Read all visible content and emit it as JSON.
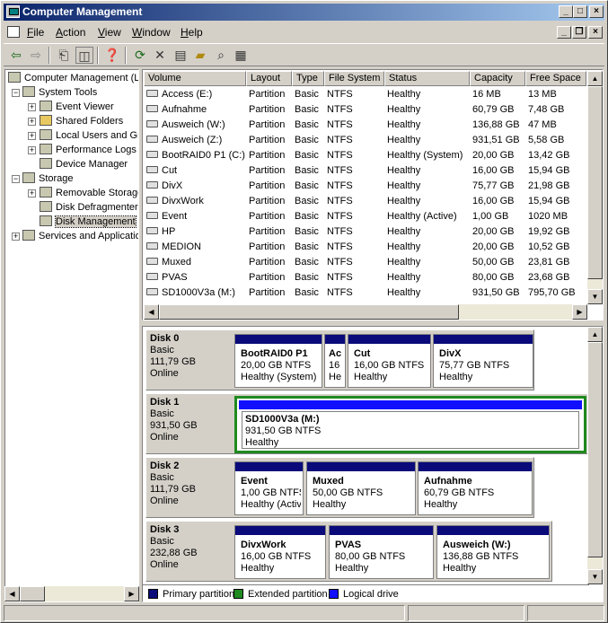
{
  "window": {
    "title": "Computer Management"
  },
  "menu": [
    "File",
    "Action",
    "View",
    "Window",
    "Help"
  ],
  "tree": [
    {
      "label": "Computer Management (Local)",
      "level": 0,
      "icon": "computer-icon"
    },
    {
      "label": "System Tools",
      "level": 1,
      "icon": "tools-icon"
    },
    {
      "label": "Event Viewer",
      "level": 2,
      "icon": "event-viewer-icon"
    },
    {
      "label": "Shared Folders",
      "level": 2,
      "icon": "shared-folders-icon"
    },
    {
      "label": "Local Users and Groups",
      "level": 2,
      "icon": "users-icon"
    },
    {
      "label": "Performance Logs and Alerts",
      "level": 2,
      "icon": "performance-icon"
    },
    {
      "label": "Device Manager",
      "level": 2,
      "icon": "device-manager-icon"
    },
    {
      "label": "Storage",
      "level": 1,
      "icon": "storage-icon"
    },
    {
      "label": "Removable Storage",
      "level": 2,
      "icon": "removable-storage-icon"
    },
    {
      "label": "Disk Defragmenter",
      "level": 2,
      "icon": "defrag-icon"
    },
    {
      "label": "Disk Management",
      "level": 2,
      "icon": "disk-management-icon",
      "selected": true
    },
    {
      "label": "Services and Applications",
      "level": 1,
      "icon": "services-icon"
    }
  ],
  "columns": [
    "Volume",
    "Layout",
    "Type",
    "File System",
    "Status",
    "Capacity",
    "Free Space"
  ],
  "volumes": [
    [
      "Access (E:)",
      "Partition",
      "Basic",
      "NTFS",
      "Healthy",
      "16 MB",
      "13 MB"
    ],
    [
      "Aufnahme",
      "Partition",
      "Basic",
      "NTFS",
      "Healthy",
      "60,79 GB",
      "7,48 GB"
    ],
    [
      "Ausweich (W:)",
      "Partition",
      "Basic",
      "NTFS",
      "Healthy",
      "136,88 GB",
      "47 MB"
    ],
    [
      "Ausweich (Z:)",
      "Partition",
      "Basic",
      "NTFS",
      "Healthy",
      "931,51 GB",
      "5,58 GB"
    ],
    [
      "BootRAID0 P1 (C:)",
      "Partition",
      "Basic",
      "NTFS",
      "Healthy (System)",
      "20,00 GB",
      "13,42 GB"
    ],
    [
      "Cut",
      "Partition",
      "Basic",
      "NTFS",
      "Healthy",
      "16,00 GB",
      "15,94 GB"
    ],
    [
      "DivX",
      "Partition",
      "Basic",
      "NTFS",
      "Healthy",
      "75,77 GB",
      "21,98 GB"
    ],
    [
      "DivxWork",
      "Partition",
      "Basic",
      "NTFS",
      "Healthy",
      "16,00 GB",
      "15,94 GB"
    ],
    [
      "Event",
      "Partition",
      "Basic",
      "NTFS",
      "Healthy (Active)",
      "1,00 GB",
      "1020 MB"
    ],
    [
      "HP",
      "Partition",
      "Basic",
      "NTFS",
      "Healthy",
      "20,00 GB",
      "19,92 GB"
    ],
    [
      "MEDION",
      "Partition",
      "Basic",
      "NTFS",
      "Healthy",
      "20,00 GB",
      "10,52 GB"
    ],
    [
      "Muxed",
      "Partition",
      "Basic",
      "NTFS",
      "Healthy",
      "50,00 GB",
      "23,81 GB"
    ],
    [
      "PVAS",
      "Partition",
      "Basic",
      "NTFS",
      "Healthy",
      "80,00 GB",
      "23,68 GB"
    ],
    [
      "SD1000V3a (M:)",
      "Partition",
      "Basic",
      "NTFS",
      "Healthy",
      "931,50 GB",
      "795,70 GB"
    ]
  ],
  "disks": [
    {
      "name": "Disk 0",
      "type": "Basic",
      "size": "111,79 GB",
      "state": "Online",
      "parts": [
        {
          "name": "BootRAID0 P1",
          "size": "20,00 GB NTFS",
          "status": "Healthy (System)"
        },
        {
          "name": "Ac",
          "size": "16",
          "status": "He"
        },
        {
          "name": "Cut",
          "size": "16,00 GB NTFS",
          "status": "Healthy"
        },
        {
          "name": "DivX",
          "size": "75,77 GB NTFS",
          "status": "Healthy"
        }
      ]
    },
    {
      "name": "Disk 1",
      "type": "Basic",
      "size": "931,50 GB",
      "state": "Online",
      "parts": [
        {
          "name": "SD1000V3a  (M:)",
          "size": "931,50 GB NTFS",
          "status": "Healthy"
        }
      ]
    },
    {
      "name": "Disk 2",
      "type": "Basic",
      "size": "111,79 GB",
      "state": "Online",
      "parts": [
        {
          "name": "Event",
          "size": "1,00 GB NTFS",
          "status": "Healthy (Active)"
        },
        {
          "name": "Muxed",
          "size": "50,00 GB NTFS",
          "status": "Healthy"
        },
        {
          "name": "Aufnahme",
          "size": "60,79 GB NTFS",
          "status": "Healthy"
        }
      ]
    },
    {
      "name": "Disk 3",
      "type": "Basic",
      "size": "232,88 GB",
      "state": "Online",
      "parts": [
        {
          "name": "DivxWork",
          "size": "16,00 GB NTFS",
          "status": "Healthy"
        },
        {
          "name": "PVAS",
          "size": "80,00 GB NTFS",
          "status": "Healthy"
        },
        {
          "name": "Ausweich  (W:)",
          "size": "136,88 GB NTFS",
          "status": "Healthy"
        }
      ]
    }
  ],
  "legend": [
    {
      "label": "Primary partition",
      "color": "#0a0a7a"
    },
    {
      "label": "Extended partition",
      "color": "#1f8a1f"
    },
    {
      "label": "Logical drive",
      "color": "#1010ff"
    }
  ]
}
